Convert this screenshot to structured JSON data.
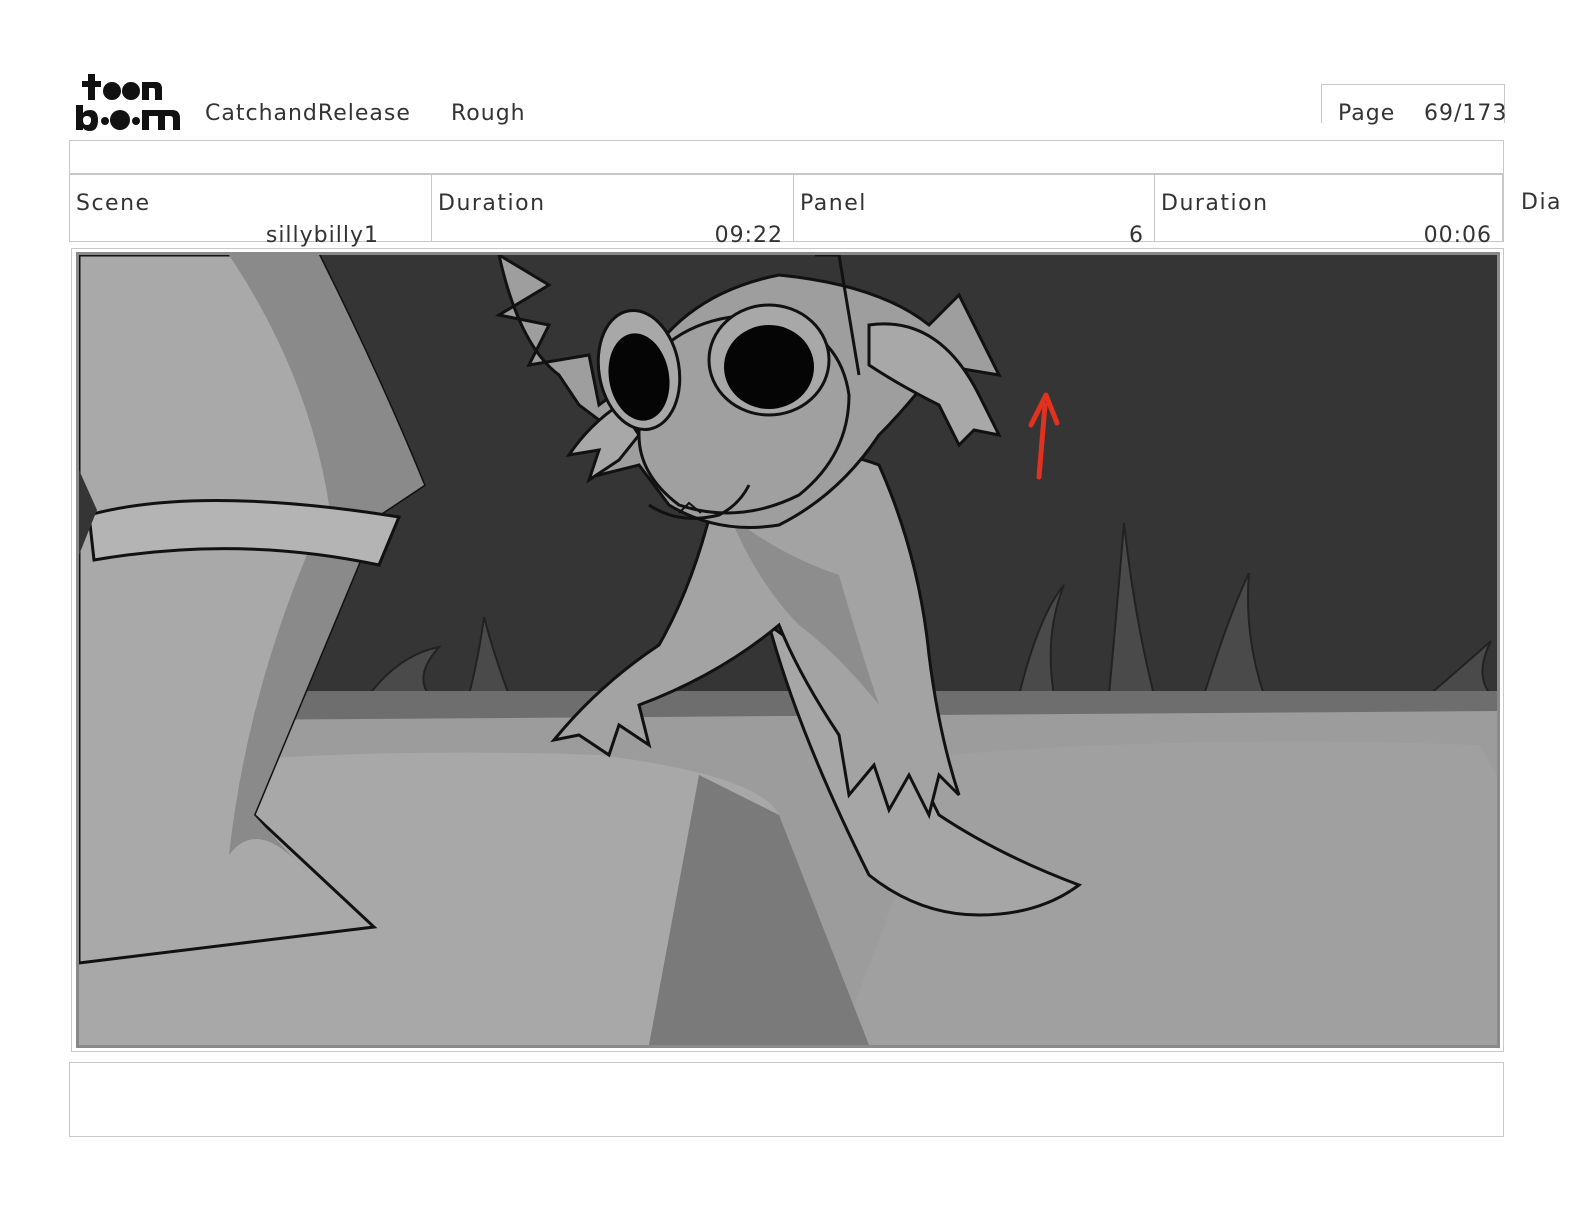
{
  "header": {
    "logo_text": "toonboom",
    "project": "CatchandRelease",
    "stage": "Rough",
    "page_label": "Page",
    "page_value": "69/173"
  },
  "info": {
    "scene_label": "Scene",
    "scene_value": "sillybilly1",
    "scene_duration_label": "Duration",
    "scene_duration_value": "09:22",
    "panel_label": "Panel",
    "panel_value": "6",
    "panel_duration_label": "Duration",
    "panel_duration_value": "00:06",
    "dialogue_label": "Dia"
  },
  "colors": {
    "annotation_arrow": "#e0321e",
    "sky": "#353535",
    "ground": "#9a9a9a"
  }
}
